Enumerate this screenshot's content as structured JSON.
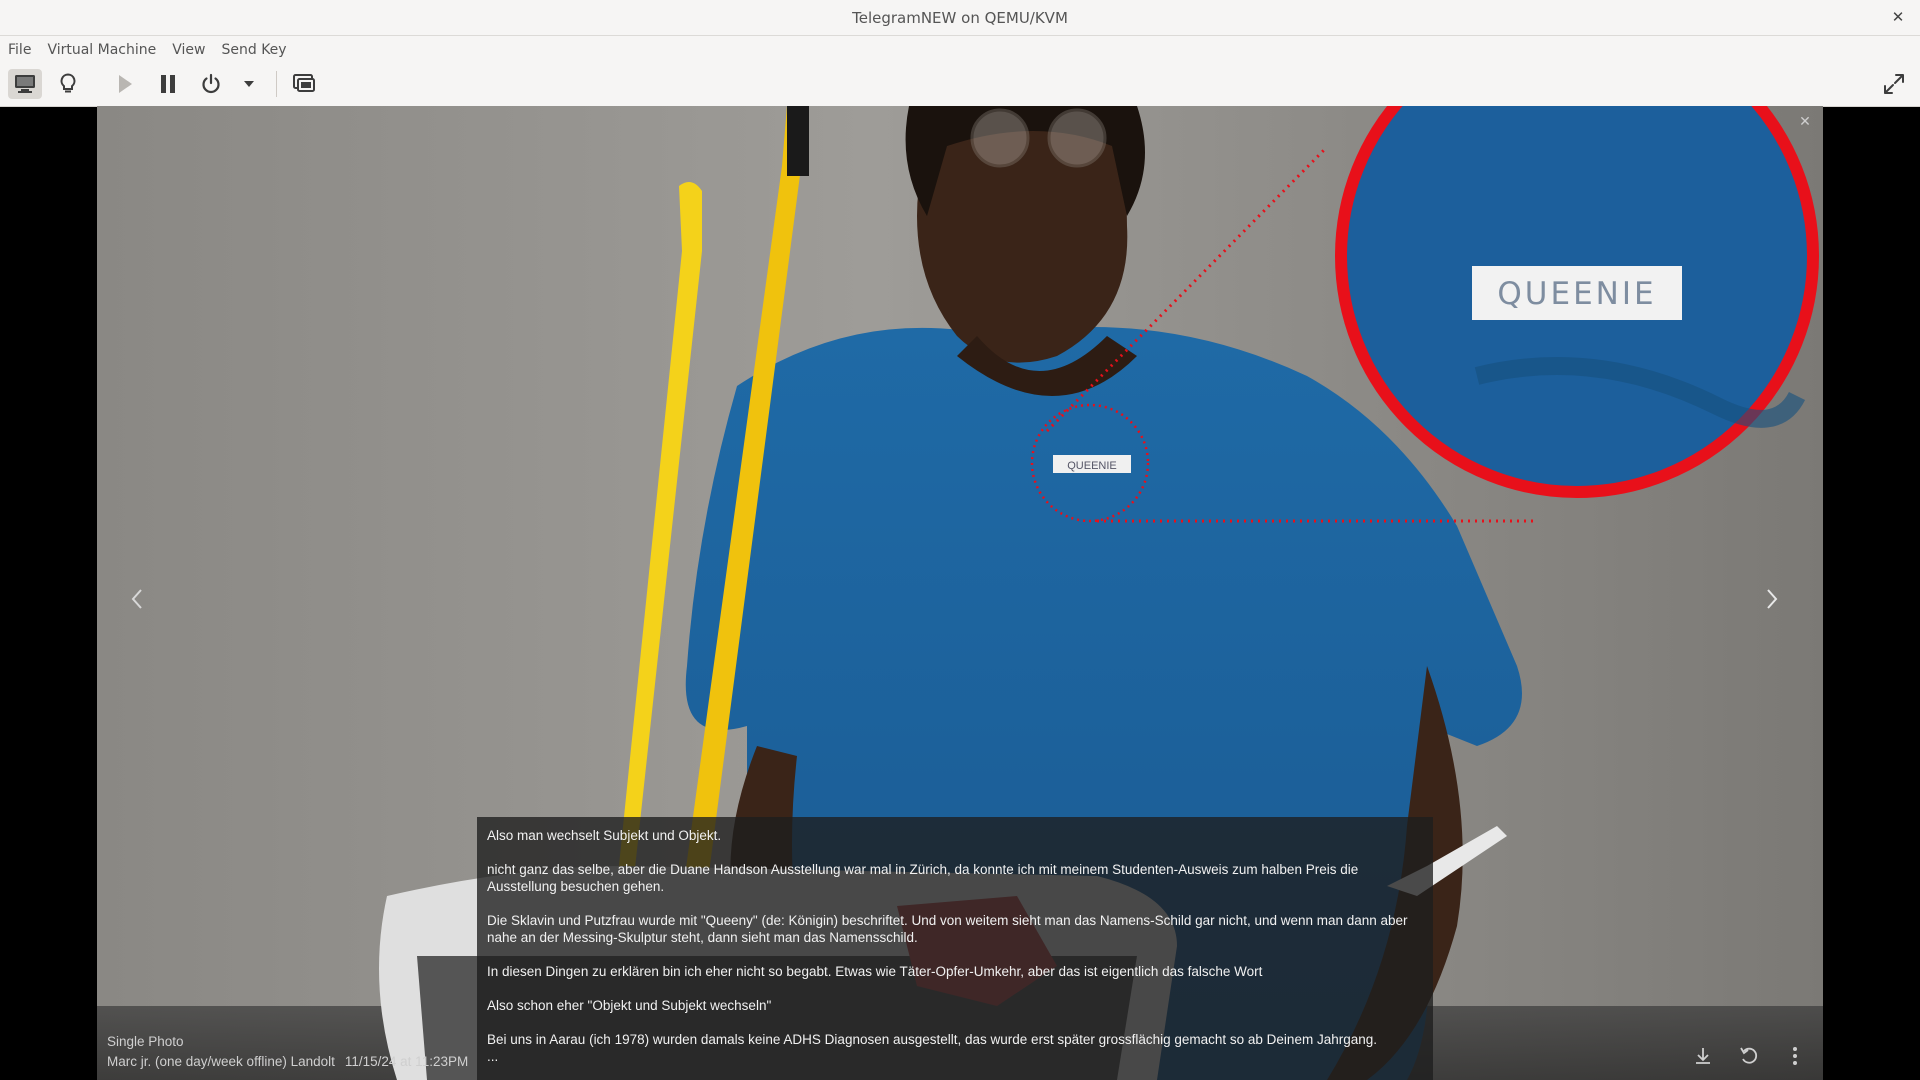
{
  "window": {
    "title": "TelegramNEW on QEMU/KVM",
    "close_icon": "close-icon"
  },
  "menu": [
    "File",
    "Virtual Machine",
    "View",
    "Send Key"
  ],
  "toolbar": {
    "icons": [
      "monitor-icon",
      "lightbulb-icon",
      "play-icon",
      "pause-icon",
      "power-icon",
      "chevron-down-icon",
      "screenshot-icon",
      "fullscreen-icon"
    ]
  },
  "photo": {
    "name_tag": "QUEENIE",
    "zoom_tag": "QUEENIE",
    "annotation_color": "#e8101a"
  },
  "caption": {
    "paragraphs": [
      "Also man wechselt Subjekt und Objekt.",
      "nicht ganz das selbe, aber die Duane Handson Ausstellung war mal in Zürich, da konnte ich mit meinem Studenten-Ausweis zum halben Preis die Ausstellung besuchen gehen.",
      "Die Sklavin und Putzfrau wurde mit \"Queeny\" (de: Königin) beschriftet. Und von weitem sieht man das Namens-Schild gar nicht, und wenn man dann aber nahe an der Messing-Skulptur steht, dann sieht man das Namensschild.",
      "In diesen Dingen zu erklären bin ich eher nicht so begabt. Etwas wie Täter-Opfer-Umkehr, aber das ist eigentlich das falsche Wort",
      "Also schon eher \"Objekt und Subjekt wechseln\"",
      "Bei uns in Aarau (ich 1978) wurden damals keine ADHS Diagnosen ausgestellt, das wurde erst später grossflächig gemacht so ab Deinem Jahrgang."
    ],
    "ellipsis": "..."
  },
  "footer": {
    "type": "Single Photo",
    "author": "Marc jr. (one day/week offline) Landolt",
    "date": "11/15/24 at 11:23PM"
  }
}
